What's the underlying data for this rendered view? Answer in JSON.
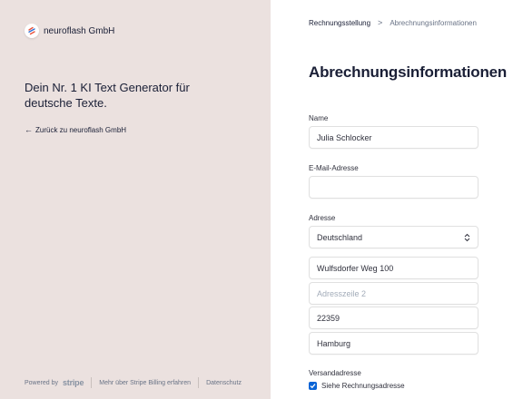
{
  "left": {
    "company_name": "neuroflash GmbH",
    "tagline": "Dein Nr. 1 KI Text Generator für deutsche Texte.",
    "back_link": "Zurück zu neuroflash GmbH",
    "back_arrow": "←",
    "footer": {
      "powered_by": "Powered by",
      "stripe": "stripe",
      "learn_more": "Mehr über Stripe Billing erfahren",
      "privacy": "Datenschutz"
    }
  },
  "right": {
    "breadcrumb": {
      "first": "Rechnungsstellung",
      "separator": ">",
      "second": "Abrechnungsinformationen"
    },
    "title": "Abrechnungsinformationen",
    "form": {
      "name_label": "Name",
      "name_value": "Julia Schlocker",
      "email_label": "E-Mail-Adresse",
      "email_value": "",
      "address_label": "Adresse",
      "country_value": "Deutschland",
      "address_line1_value": "Wulfsdorfer Weg 100",
      "address_line2_placeholder": "Adresszeile 2",
      "postal_code_value": "22359",
      "city_value": "Hamburg",
      "shipping_label": "Versandadresse",
      "same_as_billing_label": "Siehe Rechnungsadresse",
      "same_as_billing_checked": true
    }
  },
  "colors": {
    "left_background": "#ebe1df",
    "checkbox_accent": "#0a64d6",
    "logo_stripe_red": "#e8513b",
    "logo_stripe_blue": "#2b6fd6"
  },
  "icons": {
    "logo": "neuroflash-logo-icon",
    "back": "arrow-left-icon",
    "breadcrumb": "chevron-right-icon",
    "select": "chevron-up-down-icon",
    "checkbox": "checkmark-icon"
  }
}
